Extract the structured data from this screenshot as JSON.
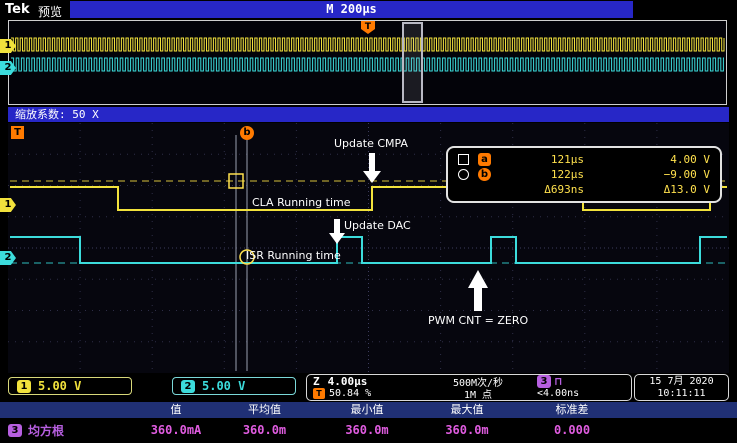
{
  "header": {
    "brand": "Tek",
    "mode": "预览",
    "timebase": "M 200μs",
    "trigger_marker": "T"
  },
  "overview": {
    "ch1_badge": "1",
    "ch2_badge": "2"
  },
  "zoom_bar": {
    "label": "缩放系数: 50 X"
  },
  "main": {
    "trigger_flag": "T",
    "cursor_b_marker": "b",
    "ch1_badge": "1",
    "ch2_badge": "2",
    "annotations": {
      "update_cmpa": "Update CMPA",
      "cla_running": "CLA Running time",
      "update_dac": "Update DAC",
      "isr_running": "ISR Running time",
      "pwm_cnt": "PWM CNT = ZERO"
    },
    "readout": {
      "a_badge": "a",
      "a_time": "121μs",
      "a_volt": "4.00 V",
      "b_badge": "b",
      "b_time": "122μs",
      "b_volt": "−9.00 V",
      "d_time": "Δ693ns",
      "d_volt": "Δ13.0 V"
    }
  },
  "status": {
    "ch1_badge": "1",
    "ch1_scale": "5.00 V",
    "ch2_badge": "2",
    "ch2_scale": "5.00 V",
    "zoom_label": "Z",
    "zoom_time": "4.00μs",
    "sample_rate": "500M次/秒",
    "ch3_badge": "3",
    "pulse_icon": "⊓",
    "trig_badge": "T",
    "trig_pos": "50.84 %",
    "points": "1M 点",
    "resolution": "<4.00ns",
    "date": "15 7月 2020",
    "time": "10:11:11"
  },
  "measure": {
    "badge": "3",
    "name": "均方根",
    "headers": [
      "值",
      "平均值",
      "最小值",
      "最大值",
      "标准差"
    ],
    "values": [
      "360.0mA",
      "360.0m",
      "360.0m",
      "360.0m",
      "0.000"
    ]
  },
  "colors": {
    "ch1": "#f2e23c",
    "ch2": "#3cdcdc",
    "ch3": "#b75fe0",
    "trigger_orange": "#ff7a00",
    "accent_blue": "#2727c7",
    "readout_yellow": "#ffe14d"
  }
}
